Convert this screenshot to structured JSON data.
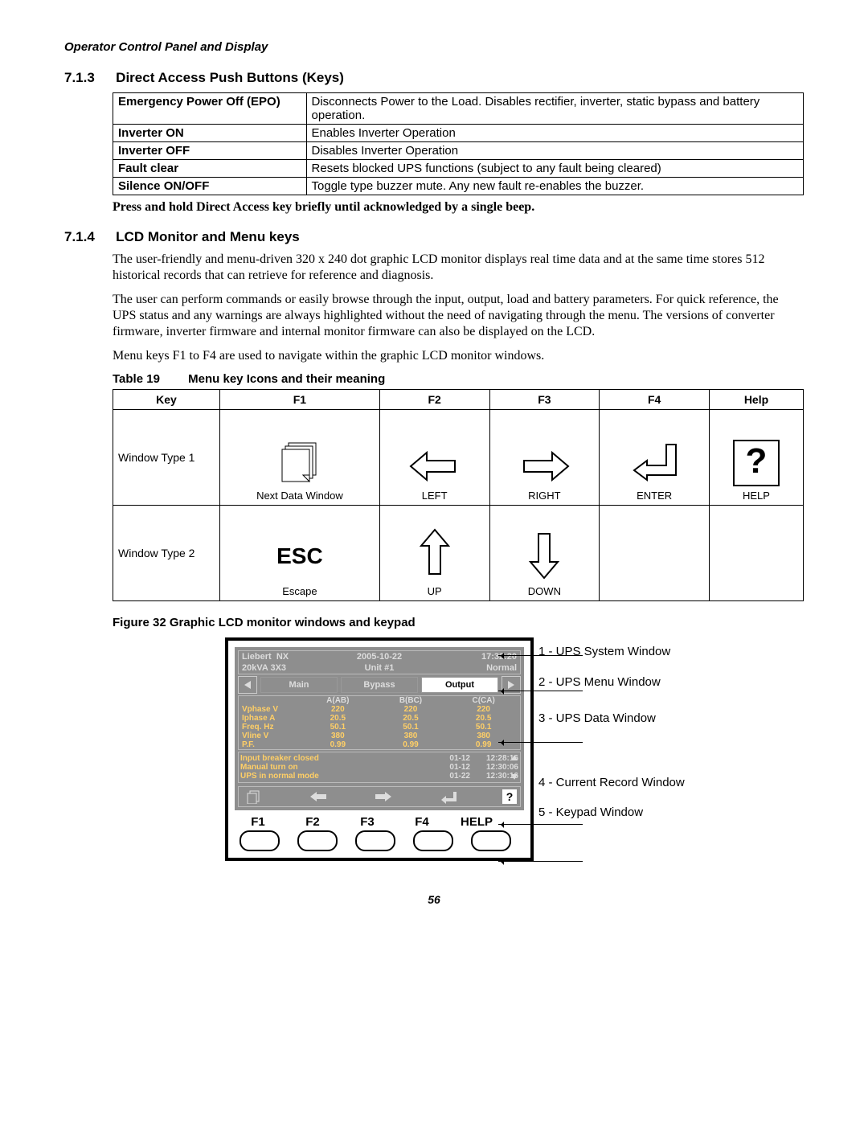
{
  "page_header": "Operator Control Panel and Display",
  "section_713": {
    "num": "7.1.3",
    "title": "Direct Access Push Buttons (Keys)"
  },
  "keys_table": [
    {
      "k": "Emergency Power Off (EPO)",
      "v": "Disconnects Power to the Load. Disables rectifier, inverter, static bypass and battery operation."
    },
    {
      "k": "Inverter ON",
      "v": "Enables Inverter Operation"
    },
    {
      "k": "Inverter OFF",
      "v": "Disables Inverter Operation"
    },
    {
      "k": "Fault clear",
      "v": "Resets blocked UPS functions (subject to any fault being cleared)"
    },
    {
      "k": "Silence ON/OFF",
      "v": "Toggle type buzzer mute. Any new fault re-enables the buzzer."
    }
  ],
  "bold_note": "Press and hold Direct Access key briefly until acknowledged by a single beep.",
  "section_714": {
    "num": "7.1.4",
    "title": "LCD Monitor and Menu keys"
  },
  "para1": "The user-friendly and menu-driven 320 x 240 dot graphic LCD monitor displays real time data and at the same time stores 512 historical records that can retrieve for reference and diagnosis.",
  "para2": "The user can perform commands or easily browse through the input, output, load and battery parameters. For quick reference, the UPS status and any warnings are always highlighted without the need of navigating through the menu. The versions of converter firmware, inverter firmware and internal monitor firmware can also be displayed on the LCD.",
  "para3": "Menu keys F1 to F4 are used to navigate within the graphic LCD monitor windows.",
  "table19_caption_label": "Table 19",
  "table19_caption_text": "Menu key Icons and their meaning",
  "icon_table": {
    "headers": [
      "Key",
      "F1",
      "F2",
      "F3",
      "F4",
      "Help"
    ],
    "row1_label": "Window Type 1",
    "row1": {
      "f1": "Next Data Window",
      "f2": "LEFT",
      "f3": "RIGHT",
      "f4": "ENTER",
      "help": "HELP",
      "help_icon": "?"
    },
    "row2_label": "Window Type 2",
    "row2": {
      "f1_big": "ESC",
      "f1": "Escape",
      "f2": "UP",
      "f3": "DOWN",
      "f4": "",
      "help": ""
    }
  },
  "fig32_caption": "Figure 32  Graphic LCD monitor windows and keypad",
  "lcd": {
    "sys": {
      "brand": "Liebert",
      "model": "NX",
      "date": "2005-10-22",
      "time": "17:32:20",
      "rating": "20kVA 3X3",
      "unit": "Unit #1",
      "status": "Normal"
    },
    "tabs": {
      "main": "Main",
      "bypass": "Bypass",
      "output": "Output"
    },
    "data_headers": [
      "A(AB)",
      "B(BC)",
      "C(CA)"
    ],
    "data_rows": [
      {
        "label": "Vphase V",
        "vals": [
          "220",
          "220",
          "220"
        ]
      },
      {
        "label": "Iphase A",
        "vals": [
          "20.5",
          "20.5",
          "20.5"
        ]
      },
      {
        "label": "Freq. Hz",
        "vals": [
          "50.1",
          "50.1",
          "50.1"
        ]
      },
      {
        "label": "Vline V",
        "vals": [
          "380",
          "380",
          "380"
        ]
      },
      {
        "label": "P.F.",
        "vals": [
          "0.99",
          "0.99",
          "0.99"
        ]
      }
    ],
    "records": [
      {
        "text": "Input breaker closed",
        "date": "01-12",
        "time": "12:28:16"
      },
      {
        "text": "Manual turn on",
        "date": "01-12",
        "time": "12:30:06"
      },
      {
        "text": "UPS in normal mode",
        "date": "01-22",
        "time": "12:30:16"
      }
    ],
    "help_glyph": "?",
    "keypad_labels": [
      "F1",
      "F2",
      "F3",
      "F4",
      "HELP"
    ]
  },
  "callouts": {
    "c1": "1 - UPS System Window",
    "c2": "2 - UPS Menu Window",
    "c3": "3 - UPS Data Window",
    "c4": "4 - Current Record Window",
    "c5": "5 - Keypad Window"
  },
  "page_number": "56"
}
